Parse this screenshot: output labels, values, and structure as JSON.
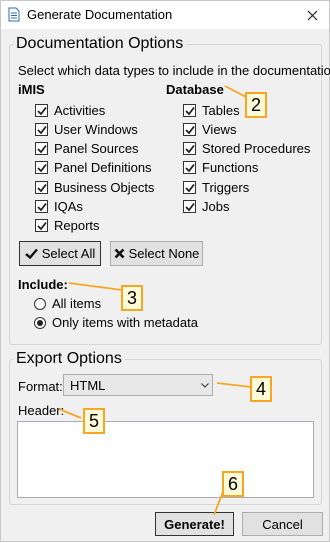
{
  "window": {
    "title": "Generate Documentation"
  },
  "doc_options": {
    "title": "Documentation Options",
    "description": "Select which data types to include in the documentation:",
    "imis": {
      "heading": "iMIS",
      "items": [
        {
          "label": "Activities",
          "checked": true
        },
        {
          "label": "User Windows",
          "checked": true
        },
        {
          "label": "Panel Sources",
          "checked": true
        },
        {
          "label": "Panel Definitions",
          "checked": true
        },
        {
          "label": "Business Objects",
          "checked": true
        },
        {
          "label": "IQAs",
          "checked": true
        },
        {
          "label": "Reports",
          "checked": true
        }
      ]
    },
    "database": {
      "heading": "Database",
      "items": [
        {
          "label": "Tables",
          "checked": true
        },
        {
          "label": "Views",
          "checked": true
        },
        {
          "label": "Stored Procedures",
          "checked": true
        },
        {
          "label": "Functions",
          "checked": true
        },
        {
          "label": "Triggers",
          "checked": true
        },
        {
          "label": "Jobs",
          "checked": true
        }
      ]
    },
    "select_all_label": "Select All",
    "select_none_label": "Select None",
    "include": {
      "label": "Include:",
      "options": [
        {
          "label": "All items",
          "selected": false
        },
        {
          "label": "Only items with metadata",
          "selected": true
        }
      ]
    }
  },
  "export_options": {
    "title": "Export Options",
    "format_label": "Format:",
    "format_value": "HTML",
    "header_label": "Header:",
    "header_value": ""
  },
  "buttons": {
    "generate_label": "Generate!",
    "cancel_label": "Cancel"
  },
  "callouts": [
    "2",
    "3",
    "4",
    "5",
    "6"
  ],
  "colors": {
    "callout_border": "#f5a623",
    "callout_fill": "#fffbd8"
  }
}
